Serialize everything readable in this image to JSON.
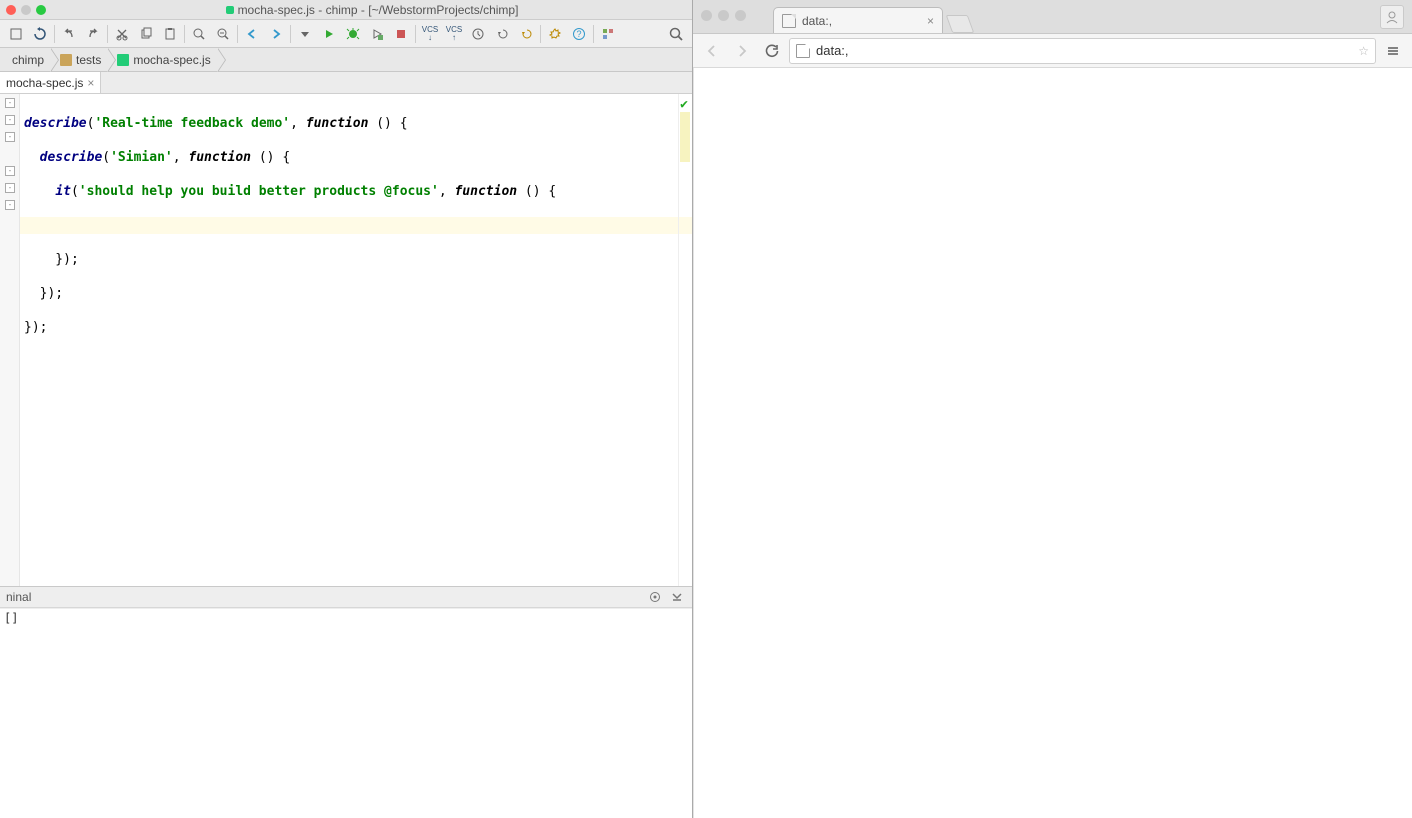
{
  "ide": {
    "title": "mocha-spec.js - chimp - [~/WebstormProjects/chimp]",
    "breadcrumbs": {
      "root": "chimp",
      "folder": "tests",
      "file": "mocha-spec.js"
    },
    "open_tab": {
      "name": "mocha-spec.js"
    },
    "code": {
      "describe_kw": "describe",
      "it_kw": "it",
      "function_kw": "function",
      "suite1_str": "'Real-time feedback demo'",
      "suite2_str": "'Simian'",
      "test_str": "'should help you build better products @focus'",
      "fn_head": " () {",
      "comma_fn": ", ",
      "open_paren": "(",
      "close_suite": "  });",
      "close_suite2": " });",
      "close_suite3": "});",
      "close_test": "    });"
    },
    "terminal": {
      "title": "ninal",
      "prompt": "[]"
    }
  },
  "browser": {
    "tab_title": "data:,",
    "url": "data:,"
  }
}
